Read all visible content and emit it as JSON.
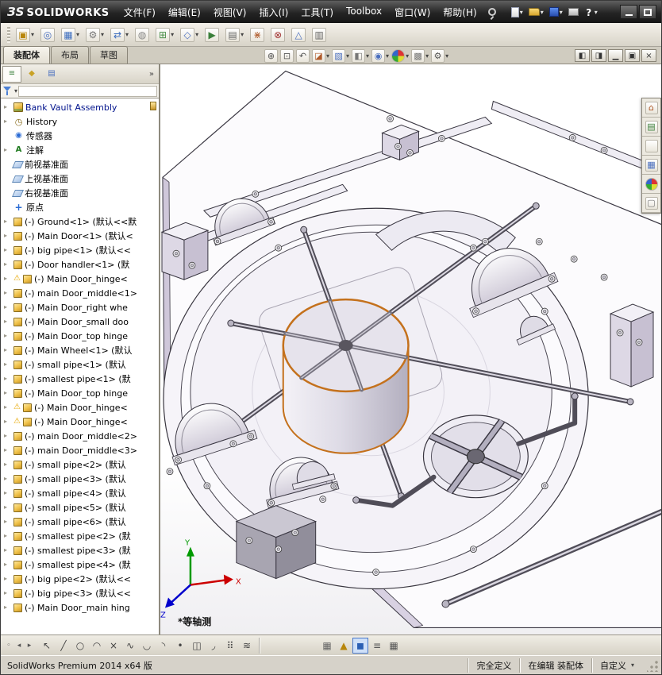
{
  "colors": {
    "highlight_orange": "#c4711c",
    "model_lavender": "#cfc7da",
    "toolbar_bg": "#d8d4c8"
  },
  "titlebar": {
    "logo_badge": "ЗS",
    "logo_text": "SOLIDWORKS",
    "menus": [
      "文件(F)",
      "编辑(E)",
      "视图(V)",
      "插入(I)",
      "工具(T)",
      "Toolbox",
      "窗口(W)",
      "帮助(H)"
    ],
    "quick_tools": [
      {
        "name": "new-document-button",
        "icon": "new",
        "dropdown": true
      },
      {
        "name": "open-document-button",
        "icon": "open",
        "dropdown": true
      },
      {
        "name": "save-document-button",
        "icon": "save",
        "dropdown": true
      },
      {
        "name": "print-document-button",
        "icon": "print",
        "dropdown": false
      },
      {
        "name": "help-button",
        "icon": "help",
        "dropdown": true
      }
    ],
    "window_buttons": [
      {
        "name": "minimize-window-button",
        "icon": "min"
      },
      {
        "name": "maximize-window-button",
        "icon": "max"
      }
    ]
  },
  "toolbar": {
    "buttons": [
      {
        "name": "insert-components-button",
        "glyph": "▣",
        "color": "#b8860b",
        "dropdown": true
      },
      {
        "name": "mate-button",
        "glyph": "◎",
        "color": "#4a6fbf",
        "dropdown": false
      },
      {
        "name": "linear-component-pattern-button",
        "glyph": "▦",
        "color": "#3f6fbf",
        "dropdown": true
      },
      {
        "name": "smart-fasteners-button",
        "glyph": "⚙",
        "color": "#777777",
        "dropdown": true
      },
      {
        "name": "move-component-button",
        "glyph": "⇄",
        "color": "#3f6fbf",
        "dropdown": true
      },
      {
        "name": "show-hidden-components-button",
        "glyph": "◍",
        "color": "#888888",
        "dropdown": false
      },
      {
        "name": "assembly-features-button",
        "glyph": "⊞",
        "color": "#4a8f4a",
        "dropdown": true
      },
      {
        "name": "reference-geometry-button",
        "glyph": "◇",
        "color": "#4a6fbf",
        "dropdown": true
      },
      {
        "name": "new-motion-study-button",
        "glyph": "▶",
        "color": "#3a7f3a",
        "dropdown": false
      },
      {
        "name": "bill-of-materials-button",
        "glyph": "▤",
        "color": "#666666",
        "dropdown": true
      },
      {
        "name": "exploded-view-button",
        "glyph": "⋇",
        "color": "#b05a2a",
        "dropdown": false
      },
      {
        "name": "interference-detection-button",
        "glyph": "⊗",
        "color": "#a03030",
        "dropdown": false
      },
      {
        "name": "instant3d-button",
        "glyph": "△",
        "color": "#4a6fbf",
        "dropdown": false
      },
      {
        "name": "large-assembly-mode-button",
        "glyph": "▥",
        "color": "#666666",
        "dropdown": false
      }
    ]
  },
  "doc_tabs": [
    {
      "name": "tab-assembly",
      "label": "装配体",
      "active": true
    },
    {
      "name": "tab-layout",
      "label": "布局",
      "active": false
    },
    {
      "name": "tab-sketch",
      "label": "草图",
      "active": false
    }
  ],
  "headsup": [
    {
      "name": "zoom-to-fit-button",
      "glyph": "⊕",
      "color": "#555555",
      "dropdown": false
    },
    {
      "name": "zoom-to-area-button",
      "glyph": "⊡",
      "color": "#555555",
      "dropdown": false
    },
    {
      "name": "previous-view-button",
      "glyph": "↶",
      "color": "#555555",
      "dropdown": false
    },
    {
      "name": "section-view-button",
      "glyph": "◪",
      "color": "#b05a2a",
      "dropdown": true
    },
    {
      "name": "view-orientation-button",
      "glyph": "▧",
      "color": "#4a6fbf",
      "dropdown": true
    },
    {
      "name": "display-style-button",
      "glyph": "◧",
      "color": "#777777",
      "dropdown": true
    },
    {
      "name": "hide-show-items-button",
      "glyph": "◉",
      "color": "#4a6fbf",
      "dropdown": true
    },
    {
      "name": "edit-appearance-button",
      "glyph": "",
      "icon": "ball",
      "dropdown": true
    },
    {
      "name": "apply-scene-button",
      "glyph": "▩",
      "color": "#777777",
      "dropdown": true
    },
    {
      "name": "view-settings-button",
      "glyph": "⚙",
      "color": "#555555",
      "dropdown": true
    }
  ],
  "docwin_buttons": [
    {
      "name": "display-pane-left-button",
      "glyph": "◧"
    },
    {
      "name": "display-pane-right-button",
      "glyph": "◨"
    },
    {
      "name": "doc-minimize-button",
      "glyph": "▁"
    },
    {
      "name": "doc-restore-button",
      "glyph": "▣"
    },
    {
      "name": "doc-close-button",
      "glyph": "×"
    }
  ],
  "panel": {
    "overflow": "»",
    "tabs": [
      {
        "name": "featuremanager-tree-tab",
        "glyph": "≡",
        "color": "#3a7f3a",
        "active": true
      },
      {
        "name": "propertymanager-tab",
        "glyph": "◆",
        "color": "#c9a227",
        "active": false
      },
      {
        "name": "configurationmanager-tab",
        "glyph": "▤",
        "color": "#4a6fbf",
        "active": false
      },
      {
        "name": "displaymanager-tab",
        "glyph": "",
        "icon": "ball",
        "active": false
      }
    ]
  },
  "tree": {
    "root": {
      "label": "Bank Vault Assembly",
      "icon": "assembly-icon"
    },
    "items": [
      {
        "label": "History",
        "icon": "history-icon",
        "arrow": true
      },
      {
        "label": "传感器",
        "icon": "sensors-icon",
        "arrow": false
      },
      {
        "label": "注解",
        "icon": "annotations-icon",
        "arrow": true
      },
      {
        "label": "前视基准面",
        "icon": "plane-icon",
        "arrow": false
      },
      {
        "label": "上视基准面",
        "icon": "plane-icon",
        "arrow": false
      },
      {
        "label": "右视基准面",
        "icon": "plane-icon",
        "arrow": false
      },
      {
        "label": "原点",
        "icon": "origin-icon",
        "arrow": false
      },
      {
        "label": "(-) Ground<1> (默认<<默",
        "icon": "component-icon",
        "arrow": true
      },
      {
        "label": "(-) Main Door<1> (默认<",
        "icon": "component-icon",
        "arrow": true
      },
      {
        "label": "(-) big pipe<1> (默认<<",
        "icon": "component-icon",
        "arrow": true
      },
      {
        "label": "(-) Door handler<1> (默",
        "icon": "component-icon",
        "arrow": true
      },
      {
        "label": "(-) Main Door_hinge<",
        "icon": "component-icon",
        "arrow": true,
        "warning": true
      },
      {
        "label": "(-) main Door_middle<1>",
        "icon": "component-icon",
        "arrow": true
      },
      {
        "label": "(-) Main Door_right whe",
        "icon": "component-icon",
        "arrow": true
      },
      {
        "label": "(-) Main Door_small doo",
        "icon": "component-icon",
        "arrow": true
      },
      {
        "label": "(-) Main Door_top hinge",
        "icon": "component-icon",
        "arrow": true
      },
      {
        "label": "(-) Main Wheel<1> (默认",
        "icon": "component-icon",
        "arrow": true
      },
      {
        "label": "(-) small pipe<1> (默认",
        "icon": "component-icon",
        "arrow": true
      },
      {
        "label": "(-) smallest pipe<1> (默",
        "icon": "component-icon",
        "arrow": true
      },
      {
        "label": "(-) Main Door_top hinge",
        "icon": "component-icon",
        "arrow": true
      },
      {
        "label": "(-) Main Door_hinge<",
        "icon": "component-icon",
        "arrow": true,
        "warning": true
      },
      {
        "label": "(-) Main Door_hinge<",
        "icon": "component-icon",
        "arrow": true,
        "warning": true
      },
      {
        "label": "(-) main Door_middle<2>",
        "icon": "component-icon",
        "arrow": true
      },
      {
        "label": "(-) main Door_middle<3>",
        "icon": "component-icon",
        "arrow": true
      },
      {
        "label": "(-) small pipe<2> (默认",
        "icon": "component-icon",
        "arrow": true
      },
      {
        "label": "(-) small pipe<3> (默认",
        "icon": "component-icon",
        "arrow": true
      },
      {
        "label": "(-) small pipe<4> (默认",
        "icon": "component-icon",
        "arrow": true
      },
      {
        "label": "(-) small pipe<5> (默认",
        "icon": "component-icon",
        "arrow": true
      },
      {
        "label": "(-) small pipe<6> (默认",
        "icon": "component-icon",
        "arrow": true
      },
      {
        "label": "(-) smallest pipe<2> (默",
        "icon": "component-icon",
        "arrow": true
      },
      {
        "label": "(-) smallest pipe<3> (默",
        "icon": "component-icon",
        "arrow": true
      },
      {
        "label": "(-) smallest pipe<4> (默",
        "icon": "component-icon",
        "arrow": true
      },
      {
        "label": "(-) big pipe<2> (默认<<",
        "icon": "component-icon",
        "arrow": true
      },
      {
        "label": "(-) big pipe<3> (默认<<",
        "icon": "component-icon",
        "arrow": true
      },
      {
        "label": "(-) Main Door_main hing",
        "icon": "component-icon",
        "arrow": true
      }
    ]
  },
  "viewport": {
    "view_label": "*等轴测",
    "triad": {
      "x": "X",
      "y": "Y",
      "z": "Z"
    }
  },
  "task_pane": [
    {
      "name": "solidworks-resources-tab",
      "glyph": "⌂",
      "color": "#b05a2a"
    },
    {
      "name": "design-library-tab",
      "glyph": "▤",
      "color": "#3a7f3a"
    },
    {
      "name": "file-explorer-tab",
      "glyph": "",
      "icon": "open"
    },
    {
      "name": "view-palette-tab",
      "glyph": "▦",
      "color": "#4a6fbf"
    },
    {
      "name": "appearances-scenes-tab",
      "glyph": "",
      "icon": "ball"
    },
    {
      "name": "custom-properties-tab",
      "glyph": "▢",
      "color": "#777777"
    }
  ],
  "sketchbar": {
    "nav": [
      {
        "name": "toolbar-options-button",
        "glyph": "◦"
      },
      {
        "name": "scroll-left-button",
        "glyph": "◂"
      },
      {
        "name": "scroll-right-button",
        "glyph": "▸"
      }
    ],
    "tools": [
      {
        "name": "select-button",
        "glyph": "↖"
      },
      {
        "name": "line-button",
        "glyph": "╱"
      },
      {
        "name": "circle-button",
        "glyph": "○"
      },
      {
        "name": "ellipse-button",
        "glyph": "◠"
      },
      {
        "name": "trim-entities-button",
        "glyph": "×"
      },
      {
        "name": "spline-button",
        "glyph": "∿"
      },
      {
        "name": "tangent-arc-button",
        "glyph": "◡"
      },
      {
        "name": "three-point-arc-button",
        "glyph": "◝"
      },
      {
        "name": "point-button",
        "glyph": "•"
      },
      {
        "name": "mirror-entities-button",
        "glyph": "◫"
      },
      {
        "name": "sketch-fillet-button",
        "glyph": "◞"
      },
      {
        "name": "linear-sketch-pattern-button",
        "glyph": "⠿"
      },
      {
        "name": "convert-entities-button",
        "glyph": "≋"
      }
    ],
    "view_tools": [
      {
        "name": "display-grid-button",
        "glyph": "▦",
        "color": "#666666"
      },
      {
        "name": "snap-options-button",
        "glyph": "▲",
        "color": "#b8860b"
      },
      {
        "name": "shaded-sketch-contours-button",
        "glyph": "◼",
        "color": "#2b5fb3",
        "active": true
      },
      {
        "name": "section-properties-button",
        "glyph": "≡",
        "color": "#555555"
      },
      {
        "name": "sketch-table-button",
        "glyph": "▦",
        "color": "#555555"
      }
    ]
  },
  "statusbar": {
    "app_version": "SolidWorks Premium 2014 x64 版",
    "define_status": "完全定义",
    "edit_status": "在编辑 装配体",
    "custom_label": "自定义"
  }
}
